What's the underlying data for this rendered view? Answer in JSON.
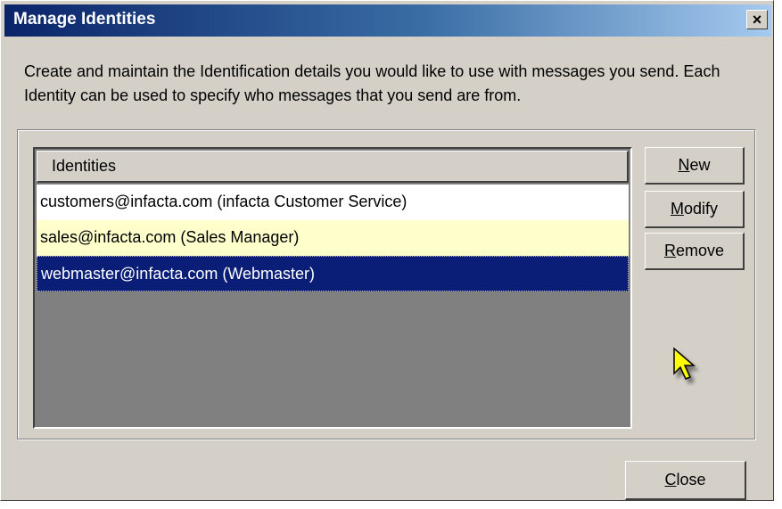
{
  "window": {
    "title": "Manage Identities",
    "close_glyph": "×"
  },
  "description": "Create and maintain the Identification details you would like to use with messages you send. Each Identity can be used to specify who messages that you send are from.",
  "identities": {
    "header": "Identities",
    "rows": [
      {
        "label": "customers@infacta.com  (infacta Customer Service)",
        "state": "normal"
      },
      {
        "label": "sales@infacta.com  (Sales Manager)",
        "state": "highlighted"
      },
      {
        "label": "webmaster@infacta.com  (Webmaster)",
        "state": "selected"
      }
    ]
  },
  "buttons": {
    "new": {
      "mnemonic": "N",
      "rest": "ew"
    },
    "modify": {
      "mnemonic": "M",
      "rest": "odify"
    },
    "remove": {
      "mnemonic": "R",
      "rest": "emove"
    },
    "close": {
      "mnemonic": "C",
      "rest": "lose"
    }
  },
  "colors": {
    "title_gradient_start": "#0a246a",
    "selection": "#0a1e78",
    "highlight_row": "#ffffcc",
    "cursor": "#ffff00"
  },
  "icons": {
    "cursor": "pointer-cursor-icon"
  }
}
